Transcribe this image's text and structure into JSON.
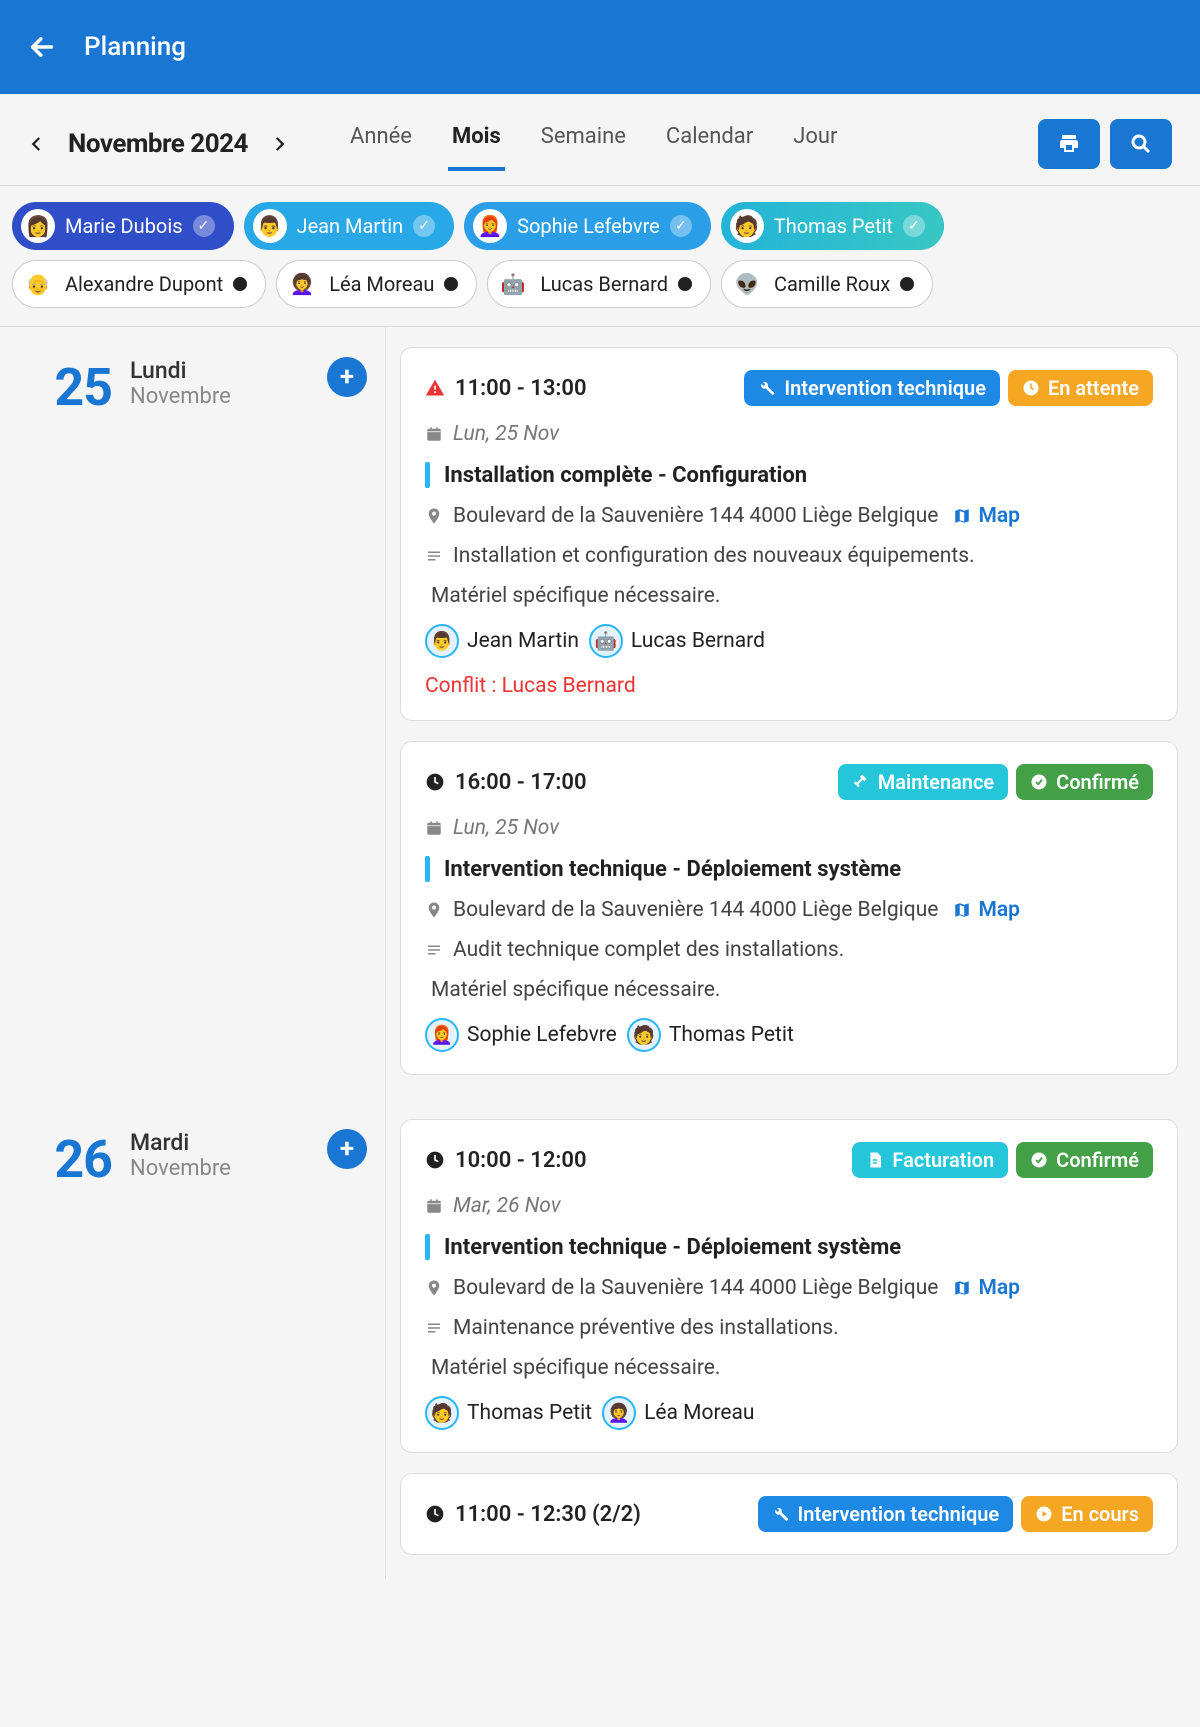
{
  "header": {
    "title": "Planning"
  },
  "nav": {
    "month_label": "Novembre 2024",
    "views": [
      "Année",
      "Mois",
      "Semaine",
      "Calendar",
      "Jour"
    ],
    "active_view_index": 1
  },
  "filters": [
    {
      "name": "Marie Dubois",
      "selected": true,
      "emoji": "👩",
      "style": "on-1"
    },
    {
      "name": "Jean Martin",
      "selected": true,
      "emoji": "👨",
      "style": "on-2"
    },
    {
      "name": "Sophie Lefebvre",
      "selected": true,
      "emoji": "👩‍🦰",
      "style": "on-3"
    },
    {
      "name": "Thomas Petit",
      "selected": true,
      "emoji": "🧑",
      "style": "on-4"
    },
    {
      "name": "Alexandre Dupont",
      "selected": false,
      "emoji": "👴",
      "style": "off"
    },
    {
      "name": "Léa Moreau",
      "selected": false,
      "emoji": "👩‍🦱",
      "style": "off"
    },
    {
      "name": "Lucas Bernard",
      "selected": false,
      "emoji": "🤖",
      "style": "off"
    },
    {
      "name": "Camille Roux",
      "selected": false,
      "emoji": "👽",
      "style": "off"
    }
  ],
  "map_label": "Map",
  "days": [
    {
      "num": "25",
      "name": "Lundi",
      "month": "Novembre",
      "events": [
        {
          "time": "11:00 - 13:00",
          "alert": true,
          "badges": [
            {
              "icon": "wrench",
              "label": "Intervention technique",
              "color": "blue"
            },
            {
              "icon": "clock",
              "label": "En attente",
              "color": "amber"
            }
          ],
          "date_line": "Lun, 25 Nov",
          "title": "Installation complète - Configuration",
          "address": "Boulevard de la Sauvenière 144 4000 Liège Belgique",
          "description": "Installation et configuration des nouveaux équipements.",
          "note": "Matériel spécifique nécessaire.",
          "assignees": [
            {
              "name": "Jean Martin",
              "emoji": "👨"
            },
            {
              "name": "Lucas Bernard",
              "emoji": "🤖"
            }
          ],
          "conflict_prefix": "Conflit :",
          "conflict_name": "Lucas Bernard"
        },
        {
          "time": "16:00 - 17:00",
          "alert": false,
          "badges": [
            {
              "icon": "tools",
              "label": "Maintenance",
              "color": "cyan"
            },
            {
              "icon": "check",
              "label": "Confirmé",
              "color": "green"
            }
          ],
          "date_line": "Lun, 25 Nov",
          "title": "Intervention technique - Déploiement système",
          "address": "Boulevard de la Sauvenière 144 4000 Liège Belgique",
          "description": "Audit technique complet des installations.",
          "note": "Matériel spécifique nécessaire.",
          "assignees": [
            {
              "name": "Sophie Lefebvre",
              "emoji": "👩‍🦰"
            },
            {
              "name": "Thomas Petit",
              "emoji": "🧑"
            }
          ]
        }
      ]
    },
    {
      "num": "26",
      "name": "Mardi",
      "month": "Novembre",
      "events": [
        {
          "time": "10:00 - 12:00",
          "alert": false,
          "badges": [
            {
              "icon": "file",
              "label": "Facturation",
              "color": "cyan"
            },
            {
              "icon": "check",
              "label": "Confirmé",
              "color": "green"
            }
          ],
          "date_line": "Mar, 26 Nov",
          "title": "Intervention technique - Déploiement système",
          "address": "Boulevard de la Sauvenière 144 4000 Liège Belgique",
          "description": "Maintenance préventive des installations.",
          "note": "Matériel spécifique nécessaire.",
          "assignees": [
            {
              "name": "Thomas Petit",
              "emoji": "🧑"
            },
            {
              "name": "Léa Moreau",
              "emoji": "👩‍🦱"
            }
          ]
        },
        {
          "time": "11:00 - 12:30 (2/2)",
          "alert": false,
          "badges": [
            {
              "icon": "wrench",
              "label": "Intervention technique",
              "color": "blue"
            },
            {
              "icon": "play",
              "label": "En cours",
              "color": "amber"
            }
          ]
        }
      ]
    }
  ]
}
